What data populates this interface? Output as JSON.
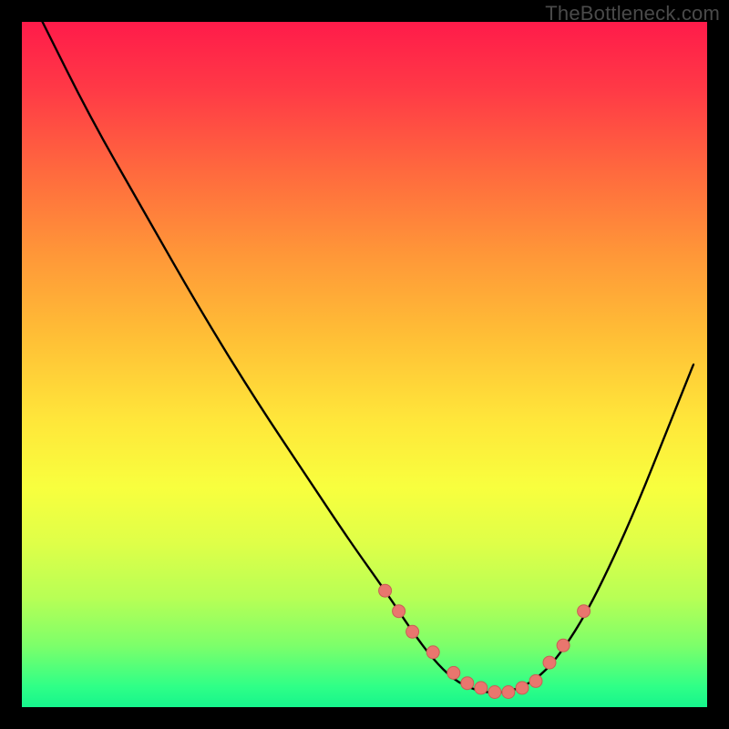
{
  "watermark": "TheBottleneck.com",
  "colors": {
    "background": "#000000",
    "dot_fill": "#e9766e",
    "dot_stroke": "#c95f55",
    "curve": "#000000"
  },
  "chart_data": {
    "type": "line",
    "title": "",
    "xlabel": "",
    "ylabel": "",
    "xlim": [
      0,
      100
    ],
    "ylim": [
      0,
      100
    ],
    "grid": false,
    "series": [
      {
        "name": "curve",
        "x": [
          3,
          10,
          18,
          26,
          34,
          42,
          48,
          53,
          57,
          60,
          63,
          66,
          69,
          72,
          75,
          78,
          82,
          86,
          90,
          94,
          98
        ],
        "values": [
          100,
          86,
          72,
          58,
          45,
          33,
          24,
          17,
          11,
          7,
          4,
          2.5,
          2,
          2.5,
          4,
          7,
          13,
          21,
          30,
          40,
          50
        ]
      }
    ],
    "dots": {
      "x": [
        53,
        55,
        57,
        60,
        63,
        65,
        67,
        69,
        71,
        73,
        75,
        77,
        79,
        82
      ],
      "values": [
        17,
        14,
        11,
        8,
        5,
        3.5,
        2.8,
        2.2,
        2.2,
        2.8,
        3.8,
        6.5,
        9,
        14
      ]
    }
  }
}
